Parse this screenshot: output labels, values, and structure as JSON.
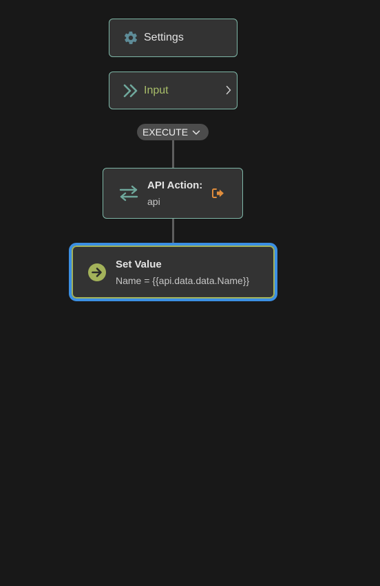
{
  "flow": {
    "settings": {
      "label": "Settings",
      "icon": "gear-icon"
    },
    "input": {
      "label": "Input",
      "icon": "double-chevron-right-icon",
      "expand_icon": "chevron-right-icon"
    },
    "execute": {
      "label": "EXECUTE",
      "icon": "chevron-down-icon"
    },
    "api_action": {
      "title": "API Action:",
      "subtitle": "api",
      "icon": "swap-arrows-icon",
      "action_icon": "exit-icon"
    },
    "set_value": {
      "title": "Set Value",
      "subtitle": "Name = {{api.data.data.Name}}",
      "icon": "arrow-right-circle-icon"
    }
  },
  "colors": {
    "background": "#181818",
    "node_background": "#333333",
    "node_border": "#7fb8a8",
    "input_text": "#a9bf6a",
    "icon_teal": "#6fa89c",
    "settings_icon": "#5e8c98",
    "exit_icon": "#e08d3c",
    "selected_outline": "#3b8fe3",
    "selected_border": "#a3b25a",
    "set_value_icon": "#a3b25a"
  }
}
